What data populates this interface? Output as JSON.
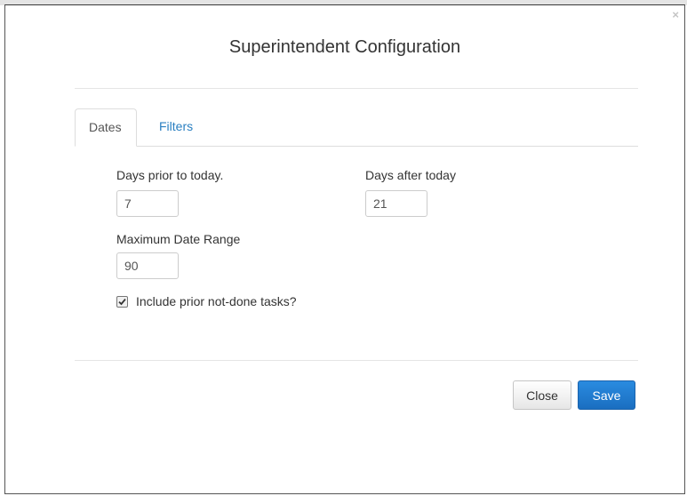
{
  "dialog": {
    "title": "Superintendent Configuration",
    "close_glyph": "×"
  },
  "tabs": [
    {
      "label": "Dates",
      "active": true
    },
    {
      "label": "Filters",
      "active": false
    }
  ],
  "fields": {
    "days_prior": {
      "label": "Days prior to today.",
      "value": "7"
    },
    "days_after": {
      "label": "Days after today",
      "value": "21"
    },
    "max_range": {
      "label": "Maximum Date Range",
      "value": "90"
    }
  },
  "include_prior": {
    "label": "Include prior not-done tasks?",
    "checked": true
  },
  "footer": {
    "close_label": "Close",
    "save_label": "Save"
  },
  "colors": {
    "accent": "#1a6ec0",
    "link": "#2a7fc1"
  }
}
